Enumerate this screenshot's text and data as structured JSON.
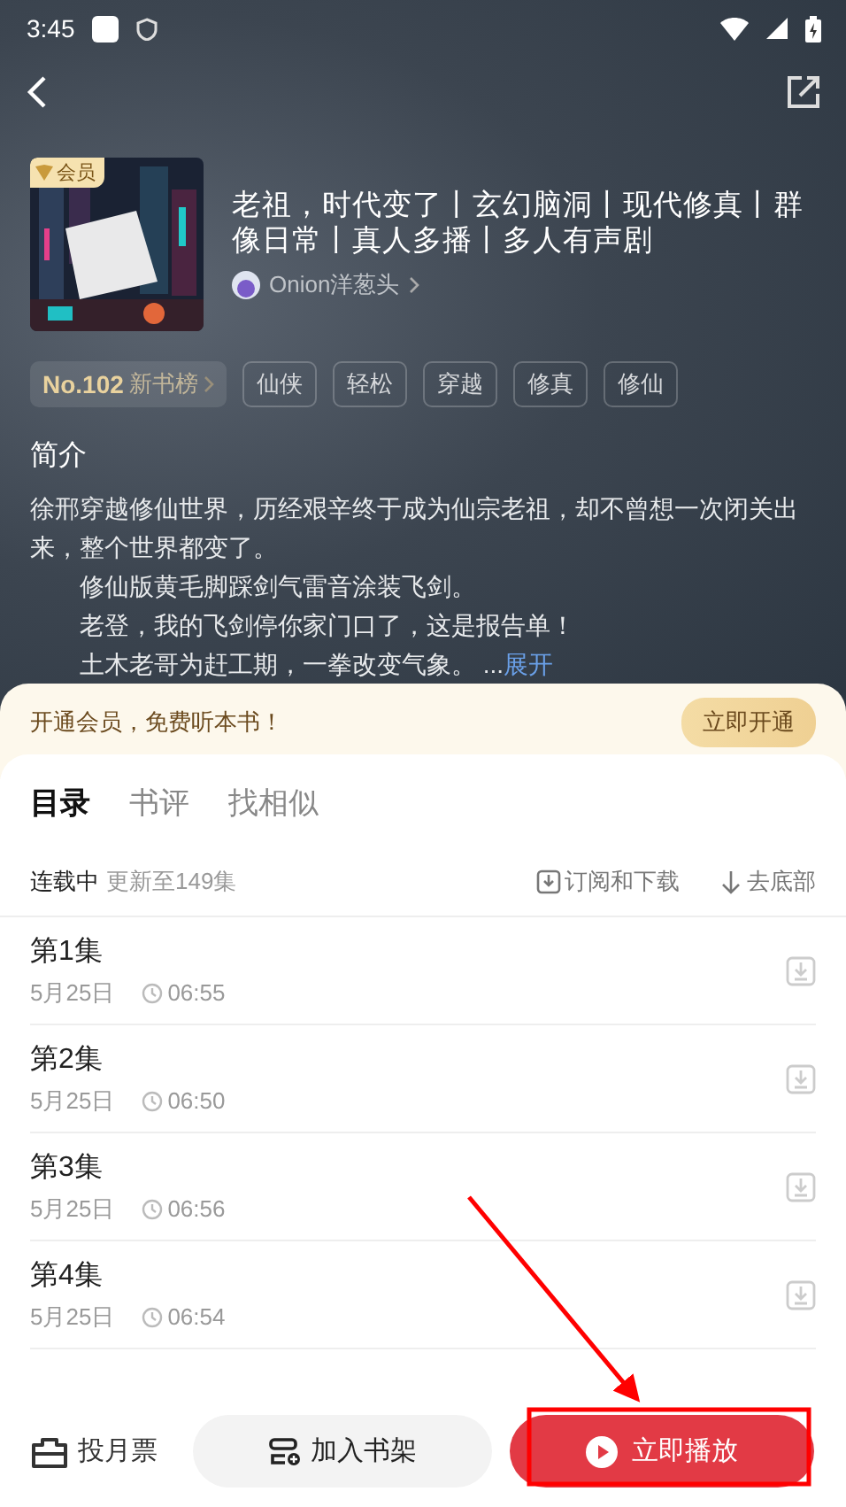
{
  "status_bar": {
    "time": "3:45"
  },
  "book": {
    "badge": "会员",
    "title": "老祖，时代变了丨玄幻脑洞丨现代修真丨群像日常丨真人多播丨多人有声剧",
    "author": "Onion洋葱头"
  },
  "rank": {
    "number": "No.102",
    "list": "新书榜"
  },
  "tags": [
    "仙侠",
    "轻松",
    "穿越",
    "修真",
    "修仙"
  ],
  "intro": {
    "heading": "简介",
    "paragraphs": [
      "徐邢穿越修仙世界，历经艰辛终于成为仙宗老祖，却不曾想一次闭关出来，整个世界都变了。",
      "　　修仙版黄毛脚踩剑气雷音涂装飞剑。",
      "　　老登，我的飞剑停你家门口了，这是报告单！",
      "　　土木老哥为赶工期，一拳改变气象。 ..."
    ],
    "expand_link": "展开"
  },
  "promo": {
    "text": "开通会员，免费听本书！",
    "button": "立即开通"
  },
  "tabs": [
    {
      "label": "目录",
      "selected": true
    },
    {
      "label": "书评",
      "selected": false
    },
    {
      "label": "找相似",
      "selected": false
    }
  ],
  "listing": {
    "status": "连载中",
    "update": "更新至149集",
    "actions": [
      {
        "kind": "download",
        "label": "订阅和下载"
      },
      {
        "kind": "jump",
        "label": "去底部"
      }
    ]
  },
  "episodes": [
    {
      "title": "第1集",
      "date": "5月25日",
      "duration": "06:55"
    },
    {
      "title": "第2集",
      "date": "5月25日",
      "duration": "06:50"
    },
    {
      "title": "第3集",
      "date": "5月25日",
      "duration": "06:56"
    },
    {
      "title": "第4集",
      "date": "5月25日",
      "duration": "06:54"
    }
  ],
  "bottom_bar": {
    "vote": "投月票",
    "shelf": "加入书架",
    "play": "立即播放"
  }
}
